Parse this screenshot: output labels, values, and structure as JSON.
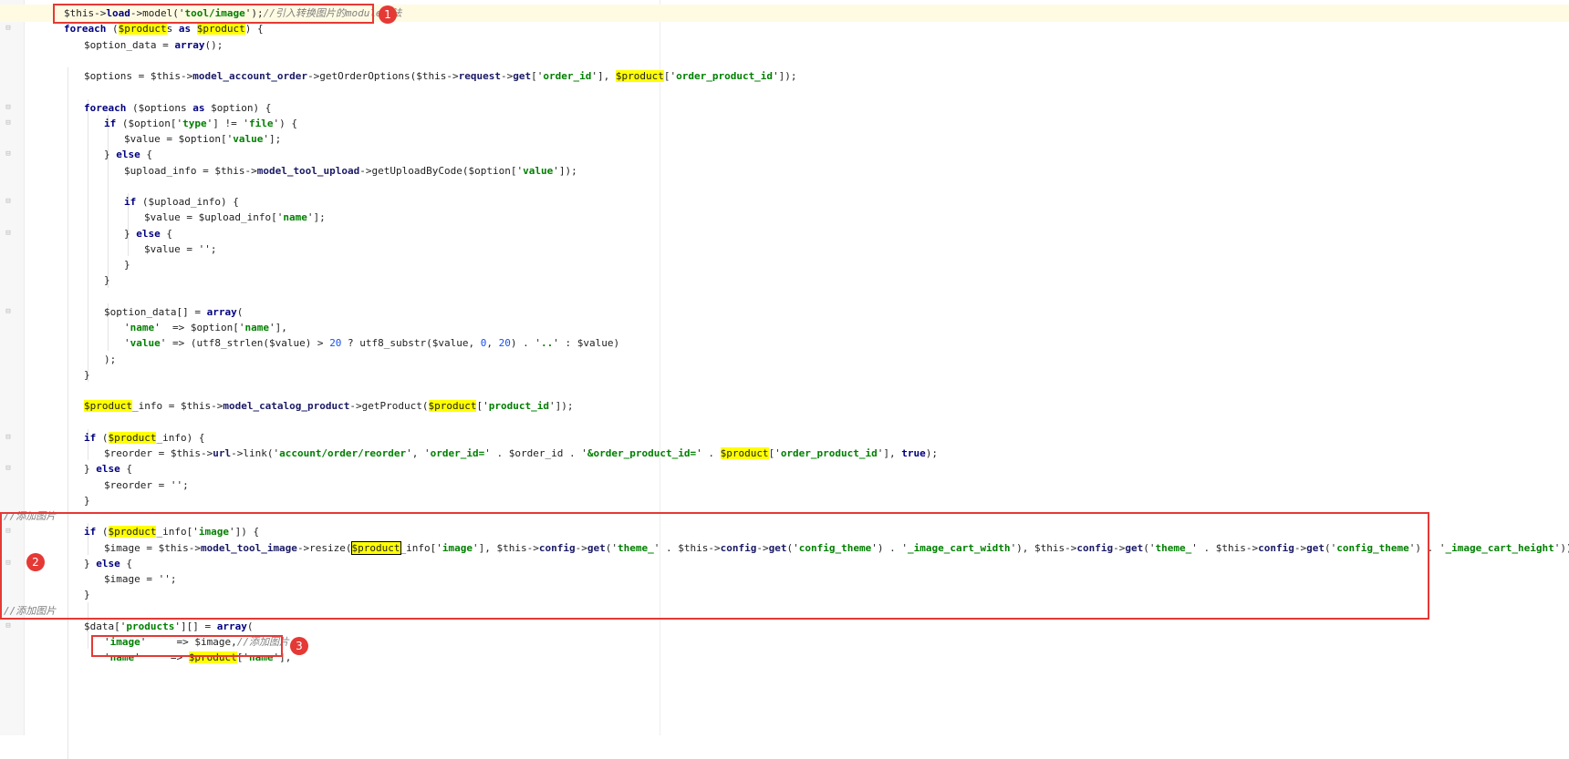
{
  "editor": {
    "lines": [
      [
        [
          "$this->",
          ""
        ],
        [
          "load",
          "kw"
        ],
        [
          "->model('",
          ""
        ],
        [
          "tool/image",
          "str"
        ],
        [
          "');",
          ""
        ],
        [
          "//引入转换图片的module方法",
          "cmt"
        ]
      ],
      [
        [
          "foreach",
          "kw"
        ],
        [
          " (",
          ""
        ],
        [
          "$product",
          "hl"
        ],
        [
          "s ",
          ""
        ],
        [
          "as",
          "kw"
        ],
        [
          " ",
          ""
        ],
        [
          "$product",
          "hl"
        ],
        [
          ") {",
          ""
        ]
      ],
      [
        [
          "$option_data = ",
          ""
        ],
        [
          "array",
          "kw"
        ],
        [
          "();",
          ""
        ]
      ],
      [],
      [
        [
          "$options = $this->",
          ""
        ],
        [
          "model_account_order",
          "fn"
        ],
        [
          "->getOrderOptions($this->",
          ""
        ],
        [
          "request",
          "fn"
        ],
        [
          "->",
          ""
        ],
        [
          "get",
          "fn"
        ],
        [
          "['",
          ""
        ],
        [
          "order_id",
          "str"
        ],
        [
          "'], ",
          ""
        ],
        [
          "$product",
          "hl"
        ],
        [
          "['",
          ""
        ],
        [
          "order_product_id",
          "str"
        ],
        [
          "']);",
          ""
        ]
      ],
      [],
      [
        [
          "foreach",
          "kw"
        ],
        [
          " ($options ",
          ""
        ],
        [
          "as",
          "kw"
        ],
        [
          " $option) {",
          ""
        ]
      ],
      [
        [
          "if",
          "kw"
        ],
        [
          " ($option['",
          ""
        ],
        [
          "type",
          "str"
        ],
        [
          "'] != '",
          ""
        ],
        [
          "file",
          "str"
        ],
        [
          "') {",
          ""
        ]
      ],
      [
        [
          "$value = $option['",
          ""
        ],
        [
          "value",
          "str"
        ],
        [
          "'];",
          ""
        ]
      ],
      [
        [
          "} ",
          ""
        ],
        [
          "else",
          "kw"
        ],
        [
          " {",
          ""
        ]
      ],
      [
        [
          "$upload_info = $this->",
          ""
        ],
        [
          "model_tool_upload",
          "fn"
        ],
        [
          "->getUploadByCode($option['",
          ""
        ],
        [
          "value",
          "str"
        ],
        [
          "']);",
          ""
        ]
      ],
      [],
      [
        [
          "if",
          "kw"
        ],
        [
          " ($upload_info) {",
          ""
        ]
      ],
      [
        [
          "$value = $upload_info['",
          ""
        ],
        [
          "name",
          "str"
        ],
        [
          "'];",
          ""
        ]
      ],
      [
        [
          "} ",
          ""
        ],
        [
          "else",
          "kw"
        ],
        [
          " {",
          ""
        ]
      ],
      [
        [
          "$value = '",
          ""
        ],
        [
          "",
          "str"
        ],
        [
          "';",
          ""
        ]
      ],
      [
        [
          "}",
          ""
        ]
      ],
      [
        [
          "}",
          ""
        ]
      ],
      [],
      [
        [
          "$option_data[] = ",
          ""
        ],
        [
          "array",
          "kw"
        ],
        [
          "(",
          ""
        ]
      ],
      [
        [
          "'",
          ""
        ],
        [
          "name",
          "str"
        ],
        [
          "'  => $option['",
          ""
        ],
        [
          "name",
          "str"
        ],
        [
          "'],",
          ""
        ]
      ],
      [
        [
          "'",
          ""
        ],
        [
          "value",
          "str"
        ],
        [
          "' => (utf8_strlen($value) > ",
          ""
        ],
        [
          "20",
          "num"
        ],
        [
          " ? utf8_substr($value, ",
          ""
        ],
        [
          "0",
          "num"
        ],
        [
          ", ",
          ""
        ],
        [
          "20",
          "num"
        ],
        [
          ") . '",
          ""
        ],
        [
          "..",
          "str"
        ],
        [
          "' : $value)",
          ""
        ]
      ],
      [
        [
          ");",
          ""
        ]
      ],
      [
        [
          "}",
          ""
        ]
      ],
      [],
      [
        [
          "$product",
          "hl"
        ],
        [
          "_info = $this->",
          ""
        ],
        [
          "model_catalog_product",
          "fn"
        ],
        [
          "->getProduct(",
          ""
        ],
        [
          "$product",
          "hl"
        ],
        [
          "['",
          ""
        ],
        [
          "product_id",
          "str"
        ],
        [
          "']);",
          ""
        ]
      ],
      [],
      [
        [
          "if",
          "kw"
        ],
        [
          " (",
          ""
        ],
        [
          "$product",
          "hl"
        ],
        [
          "_info) {",
          ""
        ]
      ],
      [
        [
          "$reorder = $this->",
          ""
        ],
        [
          "url",
          "fn"
        ],
        [
          "->link('",
          ""
        ],
        [
          "account/order/reorder",
          "str"
        ],
        [
          "', '",
          ""
        ],
        [
          "order_id=",
          "str"
        ],
        [
          "' . $order_id . '",
          ""
        ],
        [
          "&order_product_id=",
          "str"
        ],
        [
          "' . ",
          ""
        ],
        [
          "$product",
          "hl"
        ],
        [
          "['",
          ""
        ],
        [
          "order_product_id",
          "str"
        ],
        [
          "'], ",
          ""
        ],
        [
          "true",
          "kw"
        ],
        [
          ");",
          ""
        ]
      ],
      [
        [
          "} ",
          ""
        ],
        [
          "else",
          "kw"
        ],
        [
          " {",
          ""
        ]
      ],
      [
        [
          "$reorder = '",
          ""
        ],
        [
          "",
          "str"
        ],
        [
          "';",
          ""
        ]
      ],
      [
        [
          "}",
          ""
        ]
      ],
      [
        [
          "//添加图片",
          "cmt"
        ]
      ],
      [
        [
          "if",
          "kw"
        ],
        [
          " (",
          ""
        ],
        [
          "$product",
          "hl"
        ],
        [
          "_info['",
          ""
        ],
        [
          "image",
          "str"
        ],
        [
          "']) {",
          ""
        ]
      ],
      [
        [
          "$image = $this->",
          ""
        ],
        [
          "model_tool_image",
          "fn"
        ],
        [
          "->resize(",
          ""
        ],
        [
          "$product",
          "hlbox"
        ],
        [
          "_info['",
          ""
        ],
        [
          "image",
          "str"
        ],
        [
          "'], $this->",
          ""
        ],
        [
          "config",
          "fn"
        ],
        [
          "->",
          ""
        ],
        [
          "get",
          "fn"
        ],
        [
          "('",
          ""
        ],
        [
          "theme_",
          "str"
        ],
        [
          "' . $this->",
          ""
        ],
        [
          "config",
          "fn"
        ],
        [
          "->",
          ""
        ],
        [
          "get",
          "fn"
        ],
        [
          "('",
          ""
        ],
        [
          "config_theme",
          "str"
        ],
        [
          "') . '",
          ""
        ],
        [
          "_image_cart_width",
          "str"
        ],
        [
          "'), $this->",
          ""
        ],
        [
          "config",
          "fn"
        ],
        [
          "->",
          ""
        ],
        [
          "get",
          "fn"
        ],
        [
          "('",
          ""
        ],
        [
          "theme_",
          "str"
        ],
        [
          "' . $this->",
          ""
        ],
        [
          "config",
          "fn"
        ],
        [
          "->",
          ""
        ],
        [
          "get",
          "fn"
        ],
        [
          "('",
          ""
        ],
        [
          "config_theme",
          "str"
        ],
        [
          "') . '",
          ""
        ],
        [
          "_image_cart_height",
          "str"
        ],
        [
          "'))",
          ""
        ]
      ],
      [
        [
          "} ",
          ""
        ],
        [
          "else",
          "kw"
        ],
        [
          " {",
          ""
        ]
      ],
      [
        [
          "$image = '",
          ""
        ],
        [
          "",
          "str"
        ],
        [
          "';",
          ""
        ]
      ],
      [
        [
          "}",
          ""
        ]
      ],
      [
        [
          "//添加图片",
          "cmt"
        ]
      ],
      [
        [
          "$data['",
          ""
        ],
        [
          "products",
          "str"
        ],
        [
          "'][] = ",
          ""
        ],
        [
          "array",
          "kw"
        ],
        [
          "(",
          ""
        ]
      ],
      [
        [
          "'",
          ""
        ],
        [
          "image",
          "str"
        ],
        [
          "'     => $image,",
          ""
        ],
        [
          "//添加图片",
          "cmt"
        ]
      ],
      [
        [
          "'",
          ""
        ],
        [
          "name",
          "str"
        ],
        [
          "'     => ",
          ""
        ],
        [
          "$product",
          "hl"
        ],
        [
          "['",
          ""
        ],
        [
          "name",
          "str"
        ],
        [
          "'],",
          ""
        ]
      ]
    ]
  },
  "callouts": [
    {
      "number": "1"
    },
    {
      "number": "2"
    },
    {
      "number": "3"
    }
  ]
}
